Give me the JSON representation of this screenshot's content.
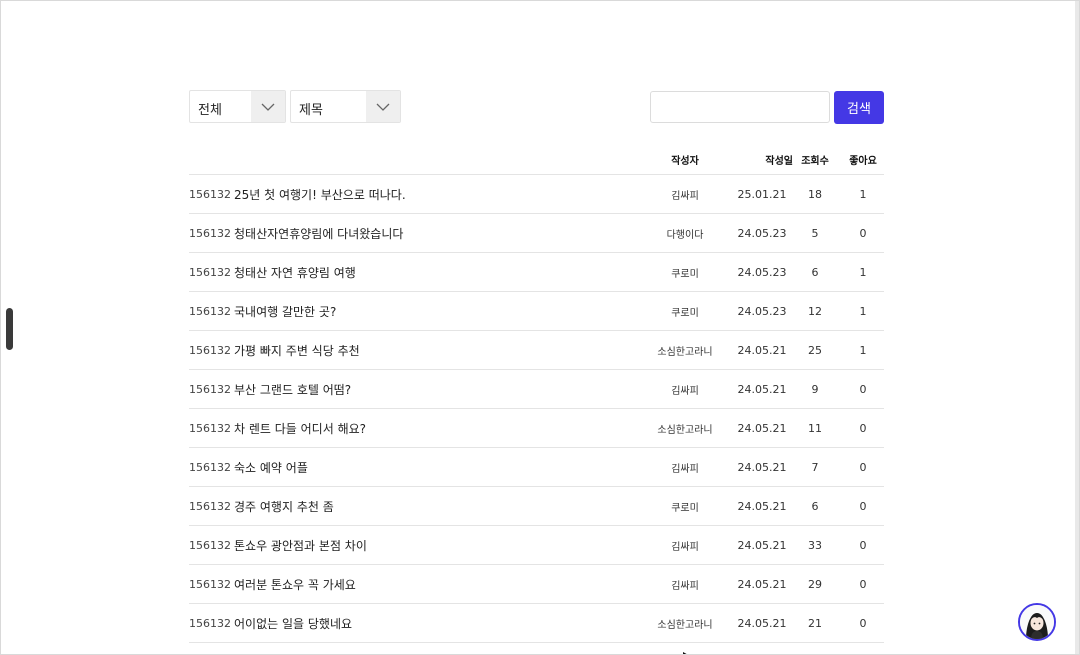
{
  "filters": {
    "category": "전체",
    "field": "제목"
  },
  "search": {
    "value": "",
    "placeholder": "",
    "button_label": "검색"
  },
  "table": {
    "headers": {
      "writer": "작성자",
      "date": "작성일",
      "views": "조회수",
      "likes": "좋아요"
    },
    "rows": [
      {
        "id": "156132",
        "title": "25년 첫 여행기! 부산으로 떠나다.",
        "writer": "김싸피",
        "date": "25.01.21",
        "views": "18",
        "likes": "1"
      },
      {
        "id": "156132",
        "title": "청태산자연휴양림에 다녀왔습니다",
        "writer": "다행이다",
        "date": "24.05.23",
        "views": "5",
        "likes": "0"
      },
      {
        "id": "156132",
        "title": "청태산 자연 휴양림 여행",
        "writer": "쿠로미",
        "date": "24.05.23",
        "views": "6",
        "likes": "1"
      },
      {
        "id": "156132",
        "title": "국내여행 갈만한 곳?",
        "writer": "쿠로미",
        "date": "24.05.23",
        "views": "12",
        "likes": "1"
      },
      {
        "id": "156132",
        "title": "가평 빠지 주변 식당 추천",
        "writer": "소심한고라니",
        "date": "24.05.21",
        "views": "25",
        "likes": "1"
      },
      {
        "id": "156132",
        "title": "부산 그랜드 호텔 어떰?",
        "writer": "김싸피",
        "date": "24.05.21",
        "views": "9",
        "likes": "0"
      },
      {
        "id": "156132",
        "title": "차 렌트 다들 어디서 해요?",
        "writer": "소심한고라니",
        "date": "24.05.21",
        "views": "11",
        "likes": "0"
      },
      {
        "id": "156132",
        "title": "숙소 예약 어플",
        "writer": "김싸피",
        "date": "24.05.21",
        "views": "7",
        "likes": "0"
      },
      {
        "id": "156132",
        "title": "경주 여행지 추천 좀",
        "writer": "쿠로미",
        "date": "24.05.21",
        "views": "6",
        "likes": "0"
      },
      {
        "id": "156132",
        "title": "톤쇼우 광안점과 본점 차이",
        "writer": "김싸피",
        "date": "24.05.21",
        "views": "33",
        "likes": "0"
      },
      {
        "id": "156132",
        "title": "여러분 톤쇼우 꼭 가세요",
        "writer": "김싸피",
        "date": "24.05.21",
        "views": "29",
        "likes": "0"
      },
      {
        "id": "156132",
        "title": "어이없는 일을 당했네요",
        "writer": "소심한고라니",
        "date": "24.05.21",
        "views": "21",
        "likes": "0"
      }
    ]
  },
  "colors": {
    "accent": "#4438e5",
    "divider": "#e4e4e4"
  },
  "icons": {
    "select_arrow": "chevron-down-icon",
    "avatar": "avatar",
    "cursor": "cursor-icon"
  }
}
